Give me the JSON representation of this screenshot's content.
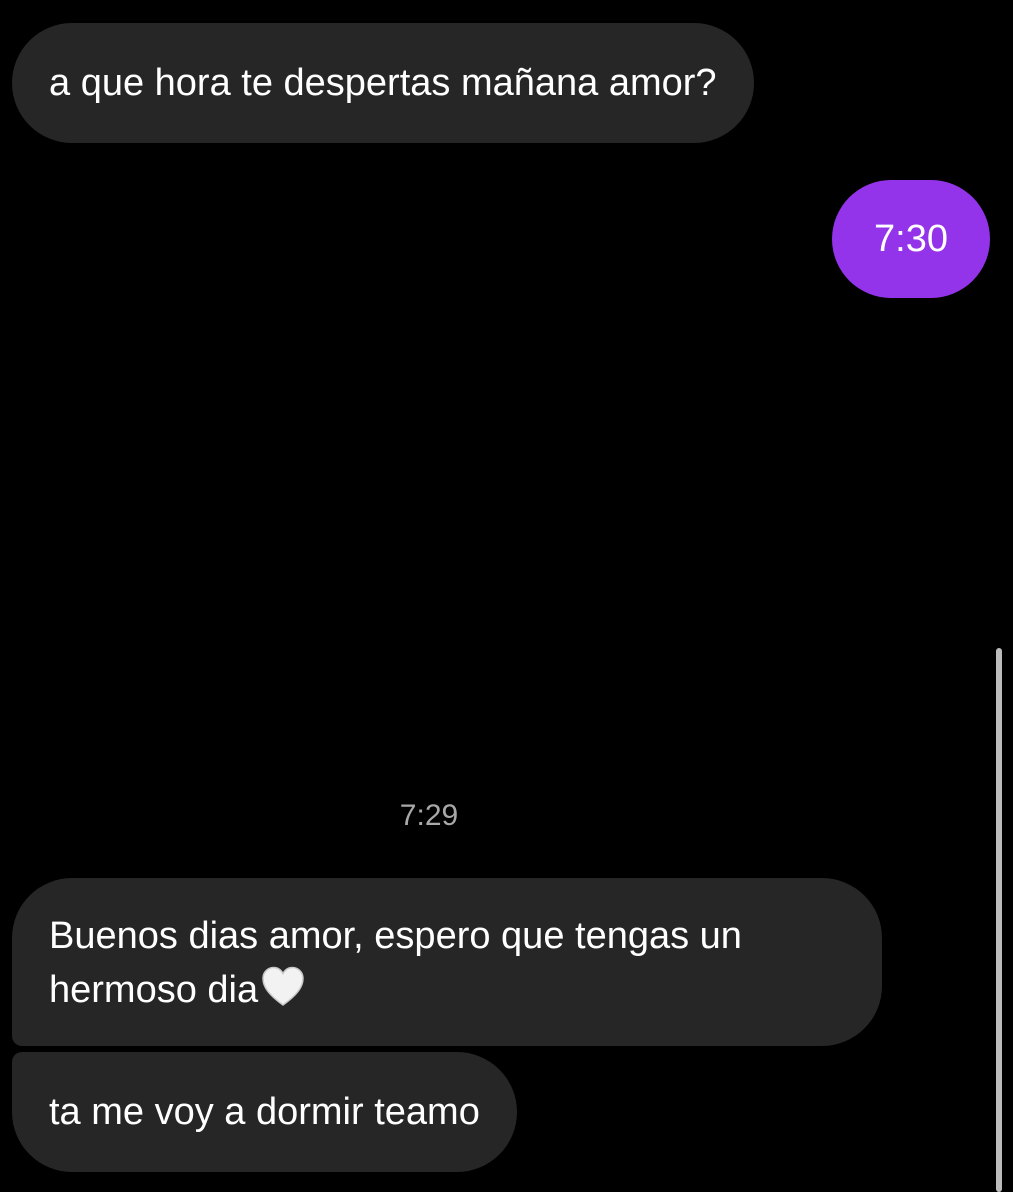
{
  "conversation": {
    "messages": [
      {
        "direction": "incoming",
        "text": "a que hora te despertas mañana amor?"
      },
      {
        "direction": "outgoing",
        "text": "7:30"
      }
    ],
    "timestamp": "7:29",
    "later_messages": [
      {
        "direction": "incoming",
        "line1": "Buenos dias amor, espero que tengas un",
        "line2": "hermoso dia",
        "emoji": "white-heart-icon"
      },
      {
        "direction": "incoming",
        "text": "ta me voy a dormir teamo"
      }
    ]
  },
  "colors": {
    "background": "#000000",
    "incoming_bubble": "#262626",
    "outgoing_bubble": "#9333ea",
    "timestamp_text": "#a8a8a8"
  }
}
